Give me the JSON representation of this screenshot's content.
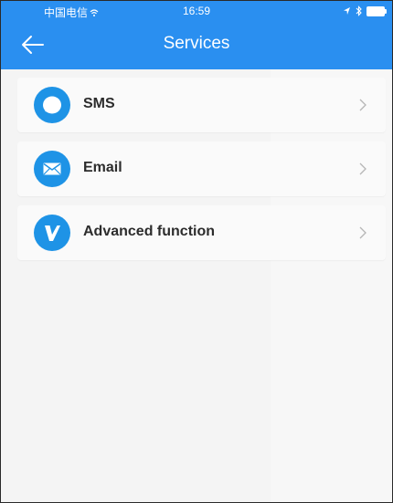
{
  "status_bar": {
    "carrier": "中国电信",
    "time": "16:59"
  },
  "header": {
    "title": "Services"
  },
  "items": [
    {
      "label": "SMS",
      "icon": "chat-bubble-icon"
    },
    {
      "label": "Email",
      "icon": "envelope-icon"
    },
    {
      "label": "Advanced function",
      "icon": "v-logo-icon"
    }
  ],
  "colors": {
    "accent": "#2a8ff0",
    "icon_bg": "#1e93e6",
    "background": "#f4f4f4"
  }
}
